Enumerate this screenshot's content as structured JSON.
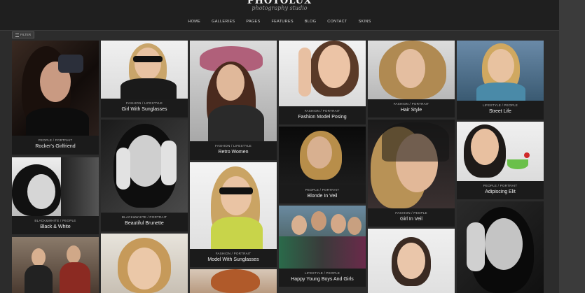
{
  "header": {
    "logo": "PHOTOLUX",
    "tagline": "photography studio"
  },
  "nav": [
    "HOME",
    "GALLERIES",
    "PAGES",
    "FEATURES",
    "BLOG",
    "CONTACT",
    "SKINS"
  ],
  "filter": {
    "label": "FILTER"
  },
  "gallery": [
    {
      "category": "PEOPLE / PORTRAIT",
      "title": "Rocker's Girlfriend"
    },
    {
      "category": "BLACK&WHITE / PEOPLE",
      "title": "Black & White"
    },
    {
      "category": "FASHION / LIFESTYLE",
      "title": "Girl With Sunglasses"
    },
    {
      "category": "BLACK&WHITE / PORTRAIT",
      "title": "Beautiful Brunette"
    },
    {
      "category": "FASHION / LIFESTYLE",
      "title": "Retro Women"
    },
    {
      "category": "FASHION / PORTRAIT",
      "title": "Model With Sunglasses"
    },
    {
      "category": "FASHION / PORTRAIT",
      "title": "Fashion Model Posing"
    },
    {
      "category": "PEOPLE / PORTRAIT",
      "title": "Blonde In Veil"
    },
    {
      "category": "LIFESTYLE / PEOPLE",
      "title": "Happy Young Boys And Girls"
    },
    {
      "category": "FASHION / PORTRAIT",
      "title": "Hair Style"
    },
    {
      "category": "FASHION / PEOPLE",
      "title": "Girl In Veil"
    },
    {
      "category": "LIFESTYLE / PEOPLE",
      "title": "Street Life"
    },
    {
      "category": "PEOPLE / PORTRAIT",
      "title": "Adipiscing Elit"
    }
  ]
}
